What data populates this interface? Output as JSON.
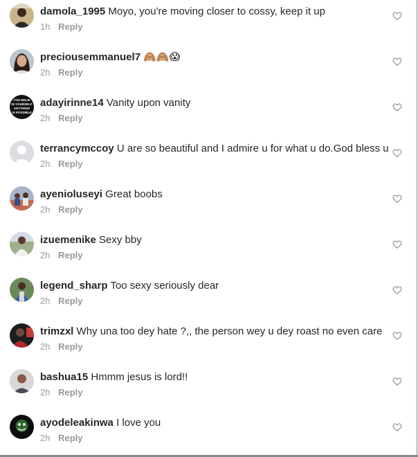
{
  "comments": [
    {
      "username": "damola_1995",
      "text": "Moyo, you're moving closer to cossy, keep it up",
      "time": "1h",
      "reply_label": "Reply",
      "avatar": "photo-man-dark",
      "like_icon": "heart-outline-icon"
    },
    {
      "username": "preciousemmanuel7",
      "text": "🙈🙈😱",
      "time": "2h",
      "reply_label": "Reply",
      "avatar": "photo-woman",
      "like_icon": "heart-outline-icon"
    },
    {
      "username": "adayirinne14",
      "text": "Vanity upon vanity",
      "time": "2h",
      "reply_label": "Reply",
      "avatar": "text-graphic",
      "avatar_text": [
        "YOU BELIE",
        "IN YOURSELF",
        "ANYTHING",
        "IS POSSIBLE"
      ],
      "like_icon": "heart-outline-icon"
    },
    {
      "username": "terrancymccoy",
      "text": "U are so beautiful and I admire u for what u do.God bless u",
      "time": "2h",
      "reply_label": "Reply",
      "avatar": "default-silhouette",
      "like_icon": "heart-outline-icon"
    },
    {
      "username": "ayenioluseyi",
      "text": "Great boobs",
      "time": "2h",
      "reply_label": "Reply",
      "avatar": "photo-group",
      "like_icon": "heart-outline-icon"
    },
    {
      "username": "izuemenike",
      "text": "Sexy bby",
      "time": "2h",
      "reply_label": "Reply",
      "avatar": "photo-man-outdoor",
      "like_icon": "heart-outline-icon"
    },
    {
      "username": "legend_sharp",
      "text": "Too sexy seriously dear",
      "time": "2h",
      "reply_label": "Reply",
      "avatar": "photo-man-shirt",
      "like_icon": "heart-outline-icon"
    },
    {
      "username": "trimzxl",
      "text": "Why una too dey hate ?,, the person wey u dey roast no even care",
      "time": "2h",
      "reply_label": "Reply",
      "avatar": "photo-red-dark",
      "like_icon": "heart-outline-icon"
    },
    {
      "username": "bashua15",
      "text": "Hmmm jesus is lord!!",
      "time": "2h",
      "reply_label": "Reply",
      "avatar": "photo-man-light",
      "like_icon": "heart-outline-icon"
    },
    {
      "username": "ayodeleakinwa",
      "text": "I love you",
      "time": "2h",
      "reply_label": "Reply",
      "avatar": "photo-dark-art",
      "like_icon": "heart-outline-icon"
    }
  ]
}
